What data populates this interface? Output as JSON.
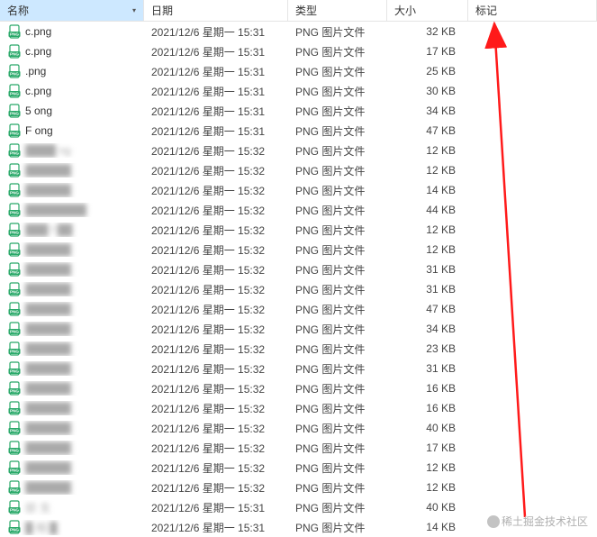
{
  "columns": {
    "name": "名称",
    "date": "日期",
    "type": "类型",
    "size": "大小",
    "tag": "标记"
  },
  "sorted_column": "name",
  "file_type_label": "PNG 图片文件",
  "watermark": "稀土掘金技术社区",
  "rows": [
    {
      "name": "c.png",
      "blur": false,
      "date": "2021/12/6 星期一 15:31",
      "size": "32 KB"
    },
    {
      "name": "c.png",
      "blur": false,
      "date": "2021/12/6 星期一 15:31",
      "size": "17 KB"
    },
    {
      "name": ".png",
      "blur": false,
      "date": "2021/12/6 星期一 15:31",
      "size": "25 KB"
    },
    {
      "name": "c.png",
      "blur": false,
      "date": "2021/12/6 星期一 15:31",
      "size": "30 KB"
    },
    {
      "name": "5 ong",
      "blur": false,
      "date": "2021/12/6 星期一 15:31",
      "size": "34 KB"
    },
    {
      "name": "F ong",
      "blur": false,
      "date": "2021/12/6 星期一 15:31",
      "size": "47 KB"
    },
    {
      "name": "████ ng",
      "blur": true,
      "date": "2021/12/6 星期一 15:32",
      "size": "12 KB"
    },
    {
      "name": "██████",
      "blur": true,
      "date": "2021/12/6 星期一 15:32",
      "size": "12 KB"
    },
    {
      "name": "██████",
      "blur": true,
      "date": "2021/12/6 星期一 15:32",
      "size": "14 KB"
    },
    {
      "name": "████████",
      "blur": true,
      "date": "2021/12/6 星期一 15:32",
      "size": "44 KB"
    },
    {
      "name": "███ f ██",
      "blur": true,
      "date": "2021/12/6 星期一 15:32",
      "size": "12 KB"
    },
    {
      "name": "██████",
      "blur": true,
      "date": "2021/12/6 星期一 15:32",
      "size": "12 KB"
    },
    {
      "name": "██████",
      "blur": true,
      "date": "2021/12/6 星期一 15:32",
      "size": "31 KB"
    },
    {
      "name": "██████",
      "blur": true,
      "date": "2021/12/6 星期一 15:32",
      "size": "31 KB"
    },
    {
      "name": "██████",
      "blur": true,
      "date": "2021/12/6 星期一 15:32",
      "size": "47 KB"
    },
    {
      "name": "██████",
      "blur": true,
      "date": "2021/12/6 星期一 15:32",
      "size": "34 KB"
    },
    {
      "name": "██████",
      "blur": true,
      "date": "2021/12/6 星期一 15:32",
      "size": "23 KB"
    },
    {
      "name": "██████",
      "blur": true,
      "date": "2021/12/6 星期一 15:32",
      "size": "31 KB"
    },
    {
      "name": "██████",
      "blur": true,
      "date": "2021/12/6 星期一 15:32",
      "size": "16 KB"
    },
    {
      "name": "██████",
      "blur": true,
      "date": "2021/12/6 星期一 15:32",
      "size": "16 KB"
    },
    {
      "name": "██████",
      "blur": true,
      "date": "2021/12/6 星期一 15:32",
      "size": "40 KB"
    },
    {
      "name": "██████",
      "blur": true,
      "date": "2021/12/6 星期一 15:32",
      "size": "17 KB"
    },
    {
      "name": "██████",
      "blur": true,
      "date": "2021/12/6 星期一 15:32",
      "size": "12 KB"
    },
    {
      "name": "██████",
      "blur": true,
      "date": "2021/12/6 星期一 15:32",
      "size": "12 KB"
    },
    {
      "name": "邸  戈",
      "blur": true,
      "date": "2021/12/6 星期一 15:31",
      "size": "40 KB"
    },
    {
      "name": "█ 相 █",
      "blur": true,
      "date": "2021/12/6 星期一 15:31",
      "size": "14 KB"
    }
  ]
}
